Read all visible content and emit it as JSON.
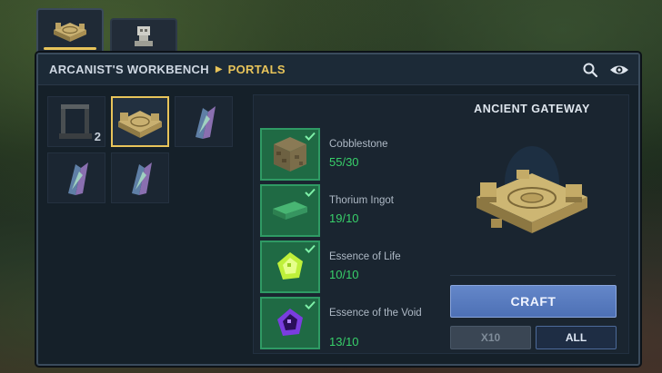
{
  "tabs": [
    {
      "name": "workbench-tab",
      "icon": "gateway-icon",
      "active": true
    },
    {
      "name": "statue-tab",
      "icon": "statue-icon",
      "active": false
    }
  ],
  "header": {
    "breadcrumb_root": "ARCANIST'S WORKBENCH",
    "breadcrumb_separator": "▶",
    "breadcrumb_leaf": "PORTALS",
    "search_icon": "search-icon",
    "view_icon": "eye-icon"
  },
  "recipes": [
    {
      "icon": "portal-frame-icon",
      "count": "2",
      "selected": false
    },
    {
      "icon": "gateway-icon",
      "count": "",
      "selected": true
    },
    {
      "icon": "crystal-icon",
      "count": "",
      "selected": false
    },
    {
      "icon": "crystal-icon",
      "count": "",
      "selected": false
    },
    {
      "icon": "crystal-icon",
      "count": "",
      "selected": false
    }
  ],
  "recipe": {
    "title": "ANCIENT GATEWAY",
    "ingredients": [
      {
        "name": "Cobblestone",
        "count": "55/30",
        "icon": "cobblestone-icon"
      },
      {
        "name": "Thorium Ingot",
        "count": "19/10",
        "icon": "thorium-ingot-icon"
      },
      {
        "name": "Essence of Life",
        "count": "10/10",
        "icon": "essence-of-life-icon"
      },
      {
        "name": "Essence of the Void",
        "count": "13/10",
        "icon": "essence-of-void-icon"
      }
    ]
  },
  "actions": {
    "craft_label": "CRAFT",
    "x10_label": "X10",
    "all_label": "ALL"
  },
  "colors": {
    "accent": "#e8c45a",
    "ok_count": "#38d06a",
    "craft": "#5a7cc0"
  }
}
